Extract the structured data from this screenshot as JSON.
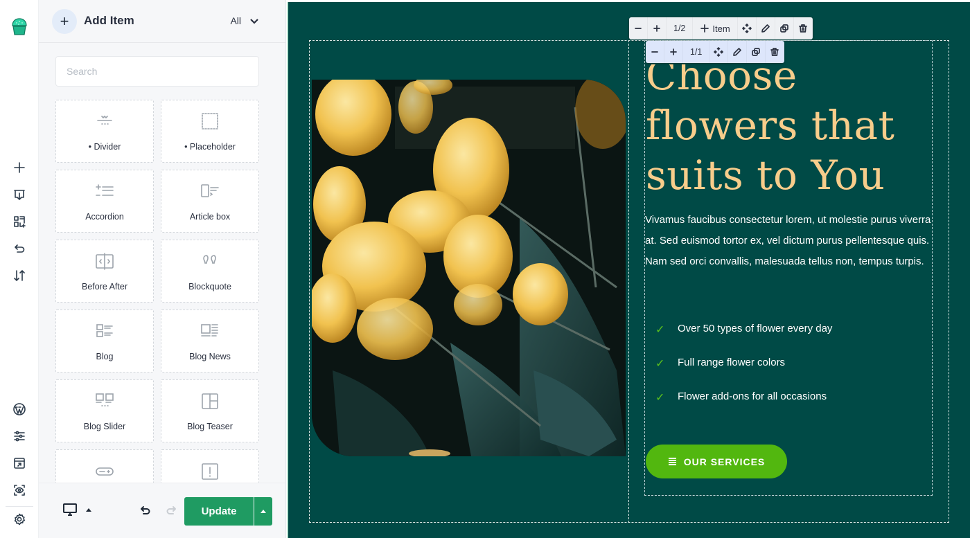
{
  "rail": {
    "top_icons": [
      "add-icon",
      "import-icon",
      "layout-add-icon",
      "history-undo-icon",
      "sort-icon"
    ],
    "bottom_icons": [
      "wordpress-icon",
      "sliders-icon",
      "preview-window-icon",
      "eye-scan-icon",
      "settings-gear-icon"
    ]
  },
  "panel": {
    "title": "Add Item",
    "filter_value": "All",
    "search_placeholder": "Search",
    "items": [
      {
        "label": "• Divider",
        "icon": "divider-icon"
      },
      {
        "label": "• Placeholder",
        "icon": "placeholder-icon"
      },
      {
        "label": "Accordion",
        "icon": "accordion-icon"
      },
      {
        "label": "Article box",
        "icon": "article-box-icon"
      },
      {
        "label": "Before After",
        "icon": "before-after-icon"
      },
      {
        "label": "Blockquote",
        "icon": "blockquote-icon"
      },
      {
        "label": "Blog",
        "icon": "blog-icon"
      },
      {
        "label": "Blog News",
        "icon": "blog-news-icon"
      },
      {
        "label": "Blog Slider",
        "icon": "blog-slider-icon"
      },
      {
        "label": "Blog Teaser",
        "icon": "blog-teaser-icon"
      },
      {
        "label": "",
        "icon": "button-icon"
      },
      {
        "label": "",
        "icon": "alert-icon"
      }
    ],
    "footer": {
      "update_label": "Update"
    }
  },
  "canvas": {
    "section_toolbar": {
      "count": "1/2",
      "add_item_label": "Item"
    },
    "column_toolbar": {
      "count": "1/1"
    },
    "headline": "Choose flowers that suits to You",
    "body": "Vivamus faucibus consectetur lorem, ut molestie purus viverra at. Sed euismod tortor ex, vel dictum purus pellentesque quis. Nam sed orci convallis, malesuada tellus non, tempus turpis.",
    "features": [
      "Over 50 types of flower every day",
      "Full range flower colors",
      "Flower add-ons for all occasions"
    ],
    "cta_label": "OUR SERVICES",
    "colors": {
      "background": "#004a46",
      "headline": "#f8cd8b",
      "accent_green": "#52b70f",
      "update_button": "#1f9b62"
    }
  }
}
